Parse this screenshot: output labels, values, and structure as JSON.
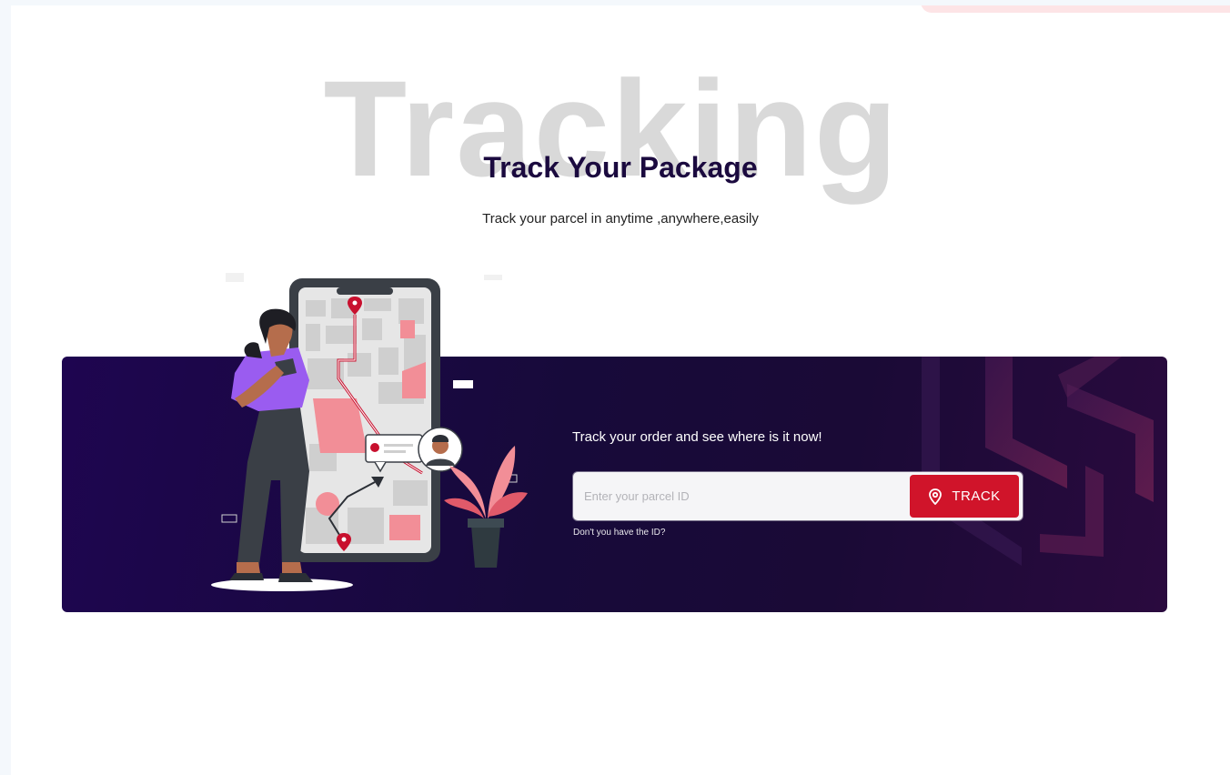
{
  "hero": {
    "watermark": "Tracking",
    "title": "Track Your Package",
    "subtitle": "Track your parcel in anytime ,anywhere,easily"
  },
  "tracker": {
    "heading": "Track your order and see where is it now!",
    "input_placeholder": "Enter your parcel ID",
    "input_value": "",
    "button_label": "TRACK",
    "button_icon": "map-pin-icon",
    "help_link": "Don't you have the ID?"
  },
  "colors": {
    "primary": "#d0142a",
    "banner_dark": "#170a3a",
    "title": "#1b0a3f",
    "watermark": "#d9d9d9"
  }
}
